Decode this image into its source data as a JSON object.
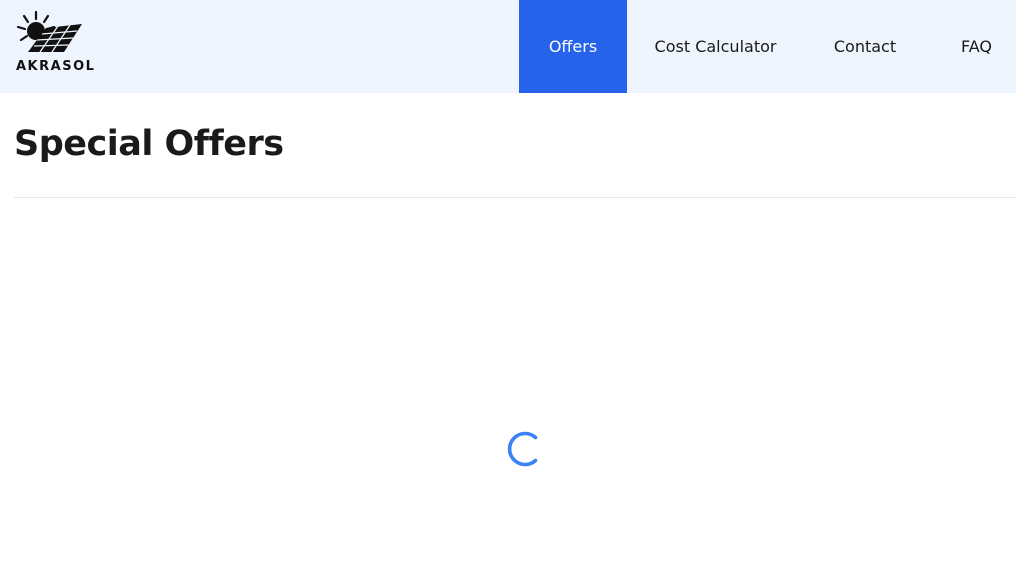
{
  "brand": {
    "logo_text": "AKRASOL"
  },
  "nav": {
    "items": [
      {
        "label": "Offers",
        "active": true
      },
      {
        "label": "Cost Calculator",
        "active": false
      },
      {
        "label": "Contact",
        "active": false
      },
      {
        "label": "FAQ",
        "active": false
      }
    ]
  },
  "main": {
    "title": "Special Offers",
    "loading_indicator": "spinner-icon"
  },
  "colors": {
    "header_bg": "#eef5ff",
    "accent": "#2563eb",
    "spinner": "#3b82f6"
  }
}
